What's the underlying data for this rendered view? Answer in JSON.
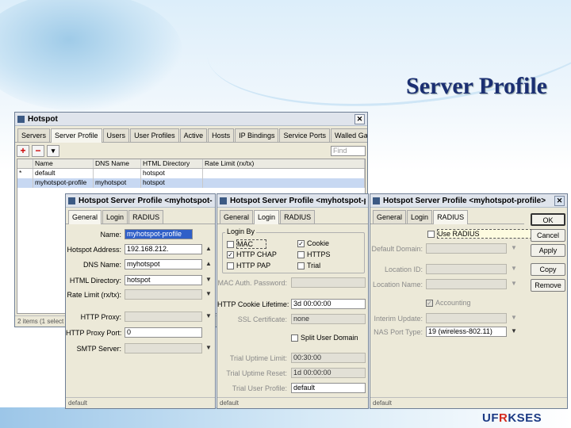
{
  "slide": {
    "title": "Server Profile",
    "logo_a": "UF",
    "logo_b": "R",
    "logo_c": "KSES"
  },
  "hotspot": {
    "title": "Hotspot",
    "tabs": [
      "Servers",
      "Server Profile",
      "Users",
      "User Profiles",
      "Active",
      "Hosts",
      "IP Bindings",
      "Service Ports",
      "Walled Garden",
      ".."
    ],
    "find_placeholder": "Find",
    "columns": [
      "Name",
      "DNS Name",
      "HTML Directory",
      "Rate Limit (rx/tx)"
    ],
    "rows": [
      {
        "flag": "*",
        "name": "default",
        "dns": "",
        "dir": "hotspot",
        "rate": ""
      },
      {
        "flag": "",
        "name": "myhotspot-profile",
        "dns": "myhotspot",
        "dir": "hotspot",
        "rate": ""
      }
    ],
    "status": "2 items (1 select"
  },
  "dialog1": {
    "title": "Hotspot Server Profile <myhotspot-pr",
    "tabs": [
      "General",
      "Login",
      "RADIUS"
    ],
    "fields": {
      "name_label": "Name:",
      "name_value": "myhotspot-profile",
      "address_label": "Hotspot Address:",
      "address_value": "192.168.212.",
      "dns_label": "DNS Name:",
      "dns_value": "myhotspot",
      "dir_label": "HTML Directory:",
      "dir_value": "hotspot",
      "rate_label": "Rate Limit (rx/tx):",
      "proxy_label": "HTTP Proxy:",
      "proxy_port_label": "HTTP Proxy Port:",
      "proxy_port_value": "0",
      "smtp_label": "SMTP Server:"
    },
    "status": "default"
  },
  "dialog2": {
    "title": "Hotspot Server Profile <myhotspot-pr",
    "tabs": [
      "General",
      "Login",
      "RADIUS"
    ],
    "login_by_label": "Login By",
    "checks": [
      {
        "label": "MAC",
        "checked": false
      },
      {
        "label": "Cookie",
        "checked": true
      },
      {
        "label": "HTTP CHAP",
        "checked": true
      },
      {
        "label": "HTTPS",
        "checked": false
      },
      {
        "label": "HTTP PAP",
        "checked": false
      },
      {
        "label": "Trial",
        "checked": false
      }
    ],
    "mac_pwd_label": "MAC Auth. Password:",
    "cookie_label": "HTTP Cookie Lifetime:",
    "cookie_value": "3d 00:00:00",
    "ssl_label": "SSL Certificate:",
    "ssl_value": "none",
    "split_label": "Split User Domain",
    "trial_uptime_label": "Trial Uptime Limit:",
    "trial_uptime_value": "00:30:00",
    "trial_reset_label": "Trial Uptime Reset:",
    "trial_reset_value": "1d 00:00:00",
    "trial_profile_label": "Trial User Profile:",
    "trial_profile_value": "default",
    "status": "default"
  },
  "dialog3": {
    "title": "Hotspot Server Profile <myhotspot-profile>",
    "tabs": [
      "General",
      "Login",
      "RADIUS"
    ],
    "use_radius_label": "Use RADIUS",
    "default_domain_label": "Default Domain:",
    "location_id_label": "Location ID:",
    "location_name_label": "Location Name:",
    "accounting_label": "Accounting",
    "interim_label": "Interim Update:",
    "nas_label": "NAS Port Type:",
    "nas_value": "19 (wireless-802.11)",
    "buttons": [
      "OK",
      "Cancel",
      "Apply",
      "Copy",
      "Remove"
    ],
    "status": "default"
  }
}
